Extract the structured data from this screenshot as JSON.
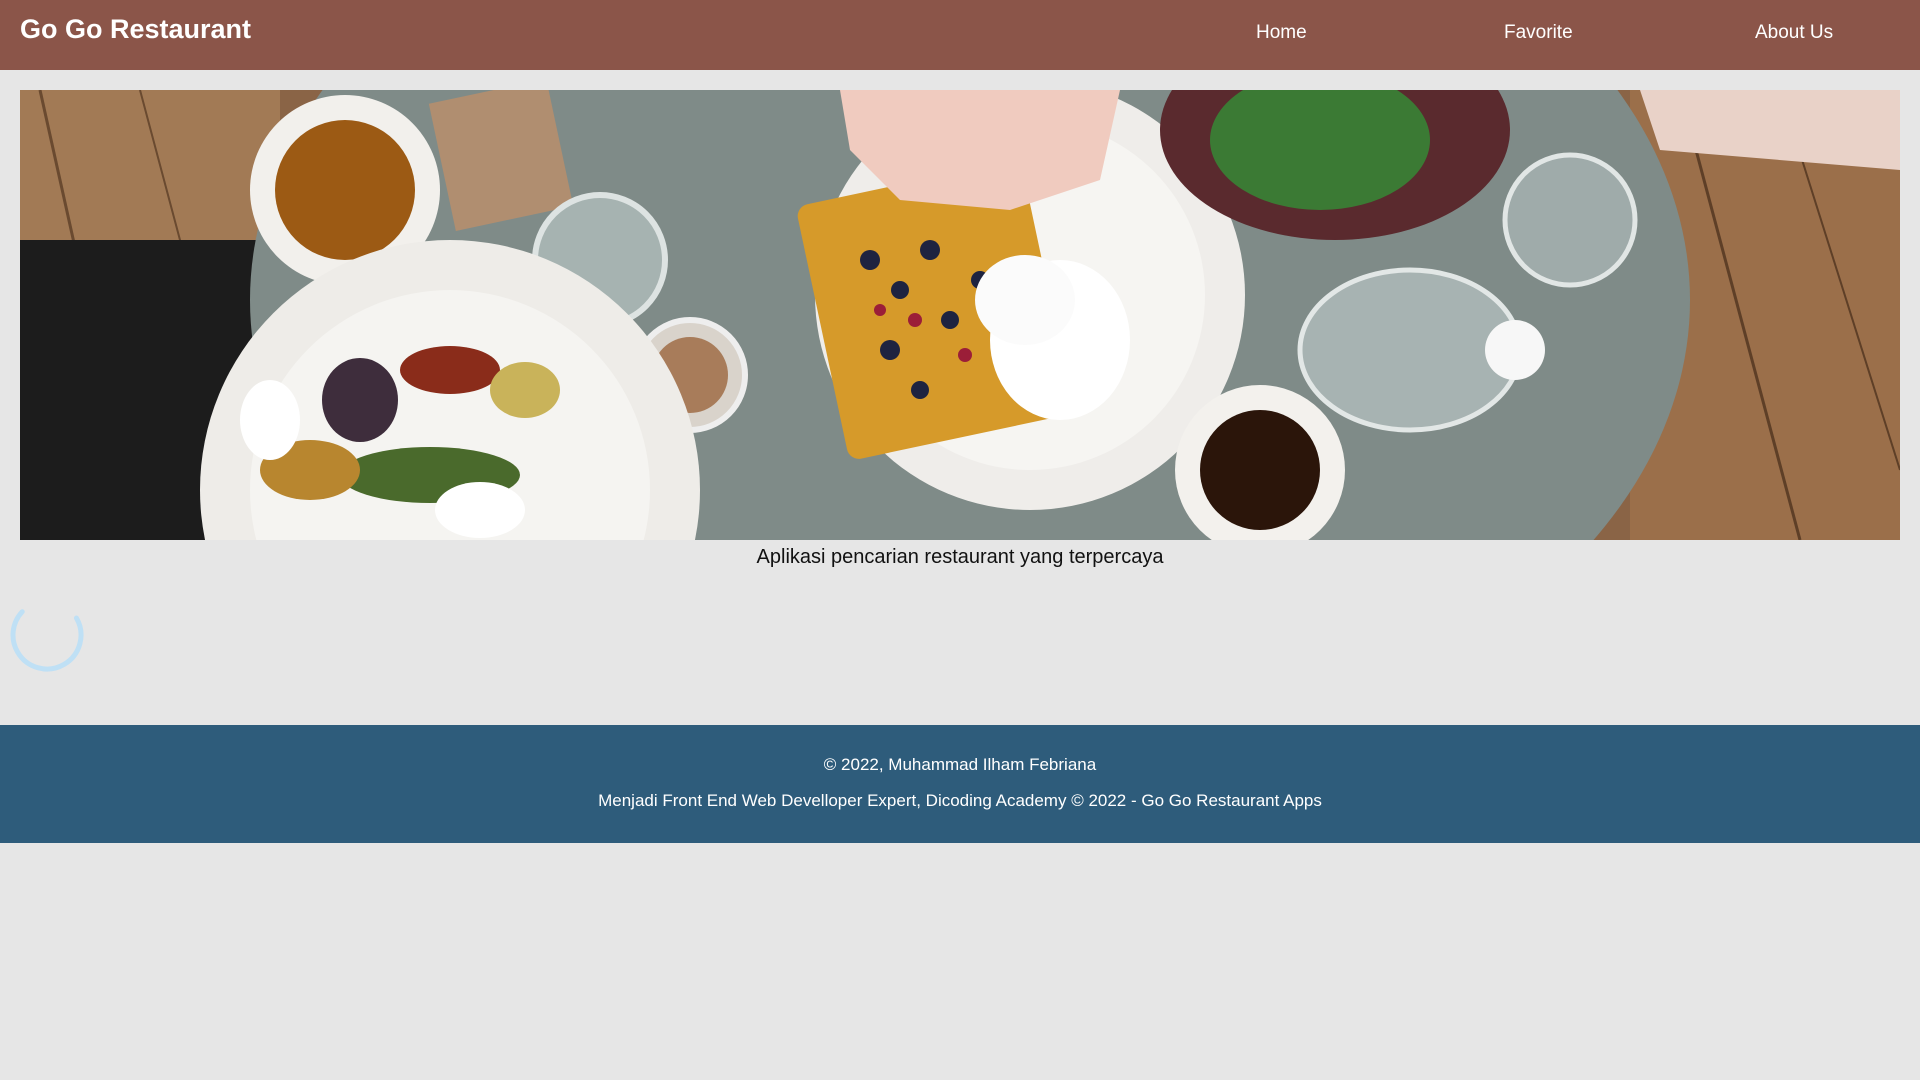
{
  "header": {
    "brand": "Go Go Restaurant",
    "nav": [
      {
        "label": "Home"
      },
      {
        "label": "Favorite"
      },
      {
        "label": "About Us"
      }
    ]
  },
  "hero": {
    "tagline": "Aplikasi pencarian restaurant yang terpercaya"
  },
  "footer": {
    "copyright": "© 2022, Muhammad Ilham Febriana",
    "description": "Menjadi Front End Web Develloper Expert, Dicoding Academy © 2022 - Go Go Restaurant Apps"
  },
  "colors": {
    "header_bg": "#8b5549",
    "footer_bg": "#2e5c7b",
    "page_bg": "#e6e6e6",
    "spinner": "#bfe0f5"
  },
  "icons": {
    "loading": "loading-spinner-icon"
  }
}
